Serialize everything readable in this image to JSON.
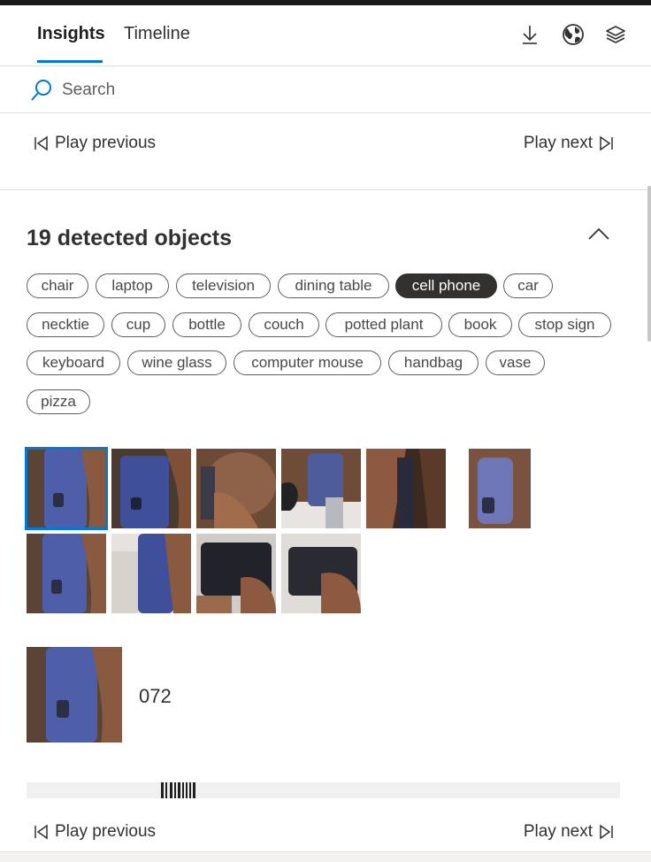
{
  "tabs": [
    {
      "label": "Insights",
      "active": true
    },
    {
      "label": "Timeline",
      "active": false
    }
  ],
  "toolbar_icons": [
    "download-icon",
    "globe-icon",
    "layers-icon"
  ],
  "search": {
    "placeholder": "Search",
    "value": ""
  },
  "play": {
    "previous_label": "Play previous",
    "next_label": "Play next"
  },
  "objects_section": {
    "title": "19 detected objects",
    "expanded": true,
    "chips": [
      {
        "label": "chair",
        "selected": false
      },
      {
        "label": "laptop",
        "selected": false
      },
      {
        "label": "television",
        "selected": false
      },
      {
        "label": "dining table",
        "selected": false
      },
      {
        "label": "cell phone",
        "selected": true
      },
      {
        "label": "car",
        "selected": false
      },
      {
        "label": "necktie",
        "selected": false
      },
      {
        "label": "cup",
        "selected": false
      },
      {
        "label": "bottle",
        "selected": false
      },
      {
        "label": "couch",
        "selected": false
      },
      {
        "label": "potted plant",
        "selected": false
      },
      {
        "label": "book",
        "selected": false
      },
      {
        "label": "stop sign",
        "selected": false
      },
      {
        "label": "keyboard",
        "selected": false
      },
      {
        "label": "wine glass",
        "selected": false
      },
      {
        "label": "computer mouse",
        "selected": false
      },
      {
        "label": "handbag",
        "selected": false
      },
      {
        "label": "vase",
        "selected": false
      },
      {
        "label": "pizza",
        "selected": false
      }
    ],
    "selected_thumbnail_index": 0,
    "thumbnail_count": 10,
    "detail": {
      "label": "072"
    }
  },
  "colors": {
    "accent": "#0078d4",
    "chip_selected_bg": "#323130",
    "text": "#323130"
  }
}
